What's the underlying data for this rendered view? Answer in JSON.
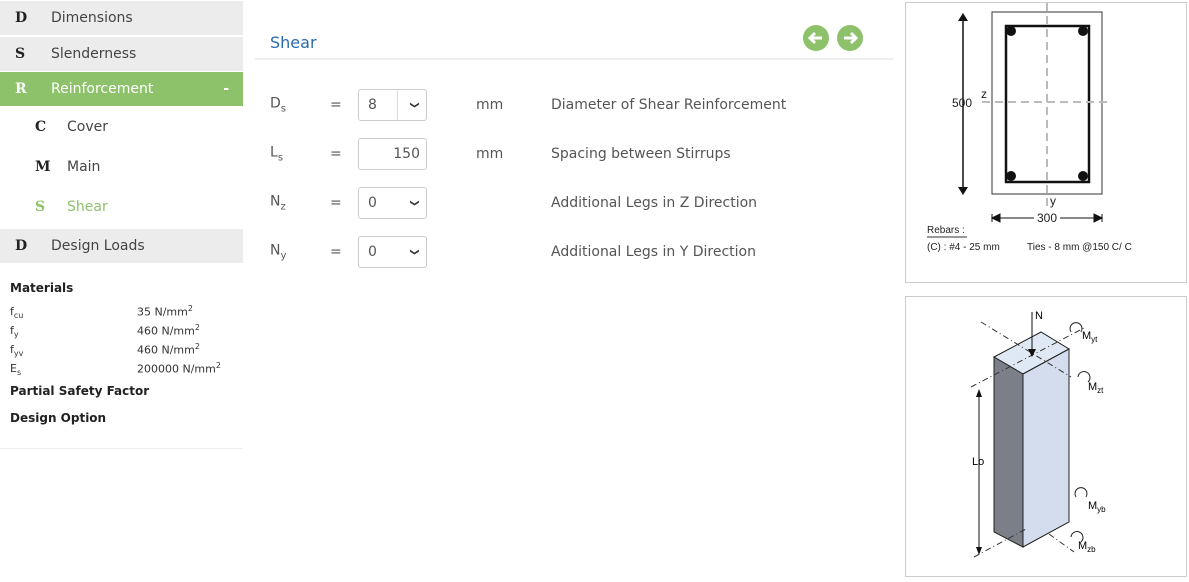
{
  "sidebar": {
    "items": [
      {
        "letter": "D",
        "label": "Dimensions"
      },
      {
        "letter": "S",
        "label": "Slenderness"
      },
      {
        "letter": "R",
        "label": "Reinforcement",
        "toggle": "-"
      },
      {
        "letter": "D",
        "label": "Design Loads"
      }
    ],
    "subitems": [
      {
        "letter": "C",
        "label": "Cover"
      },
      {
        "letter": "M",
        "label": "Main"
      },
      {
        "letter": "S",
        "label": "Shear"
      }
    ]
  },
  "summary": {
    "materials_title": "Materials",
    "materials": [
      {
        "sym": "f",
        "sub": "cu",
        "value": "35 N/mm",
        "sup": "2"
      },
      {
        "sym": "f",
        "sub": "y",
        "value": "460 N/mm",
        "sup": "2"
      },
      {
        "sym": "f",
        "sub": "yv",
        "value": "460 N/mm",
        "sup": "2"
      },
      {
        "sym": "E",
        "sub": "s",
        "value": "200000 N/mm",
        "sup": "2"
      }
    ],
    "partial_safety": "Partial Safety Factor",
    "design_option": "Design Option"
  },
  "main": {
    "title": "Shear",
    "rows": [
      {
        "sym": "D",
        "sub": "s",
        "eq": "=",
        "value": "8",
        "type": "select",
        "unit": "mm",
        "desc": "Diameter of Shear Reinforcement"
      },
      {
        "sym": "L",
        "sub": "s",
        "eq": "=",
        "value": "150",
        "type": "input",
        "unit": "mm",
        "desc": "Spacing between Stirrups"
      },
      {
        "sym": "N",
        "sub": "z",
        "eq": "=",
        "value": "0",
        "type": "select",
        "unit": "",
        "desc": "Additional Legs in Z Direction"
      },
      {
        "sym": "N",
        "sub": "y",
        "eq": "=",
        "value": "0",
        "type": "select",
        "unit": "",
        "desc": "Additional Legs in Y Direction"
      }
    ]
  },
  "section": {
    "depth": "500",
    "width": "300",
    "z": "z",
    "y": "y",
    "rebars_title": "Rebars :",
    "rebars": "(C) : #4 - 25 mm",
    "ties": "Ties - 8 mm @150 C/ C"
  },
  "column": {
    "N": "N",
    "Myt": "M",
    "Myt_sub": "yt",
    "Mzt": "M",
    "Mzt_sub": "zt",
    "Myb": "M",
    "Myb_sub": "yb",
    "Mzb": "M",
    "Mzb_sub": "zb",
    "Lo": "L",
    "Lo_sub": "o"
  },
  "colors": {
    "accent": "#8dc26b",
    "title": "#2a6aad"
  }
}
